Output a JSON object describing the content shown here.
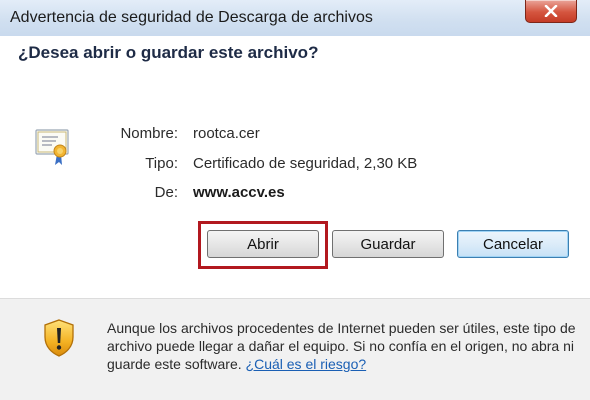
{
  "window": {
    "title": "Advertencia de seguridad de Descarga de archivos",
    "close_icon": "close-icon"
  },
  "dialog": {
    "question": "¿Desea abrir o guardar este archivo?",
    "file_icon": "certificate-icon",
    "fields": [
      {
        "label": "Nombre:",
        "value": "rootca.cer"
      },
      {
        "label": "Tipo:",
        "value": "Certificado de seguridad, 2,30 KB"
      },
      {
        "label": "De:",
        "value": "www.accv.es"
      }
    ],
    "buttons": {
      "open": "Abrir",
      "save": "Guardar",
      "cancel": "Cancelar"
    },
    "highlight_color": "#b2181f"
  },
  "footer": {
    "icon": "warning-shield-icon",
    "message": "Aunque los archivos procedentes de Internet pueden ser útiles, este tipo de archivo puede llegar a dañar el equipo. Si no confía en el origen, no abra ni guarde este software.",
    "link": "¿Cuál es el riesgo?"
  }
}
